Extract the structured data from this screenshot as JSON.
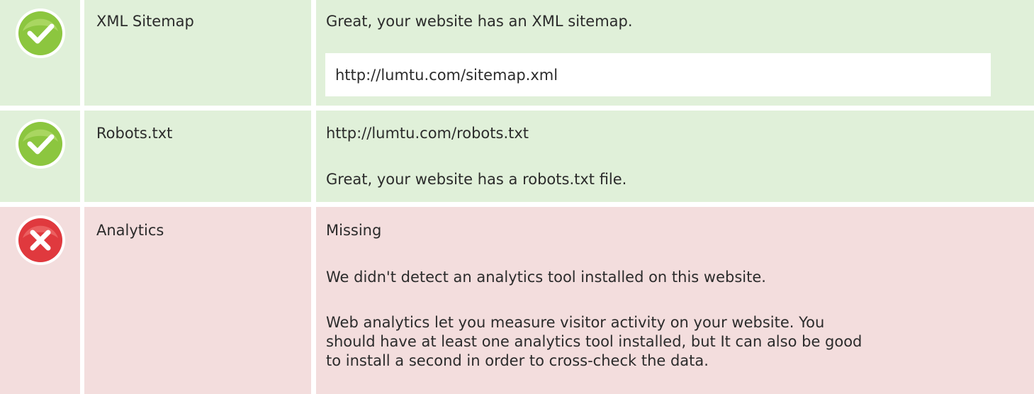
{
  "rows": [
    {
      "status": "pass",
      "icon": "check-circle-icon",
      "label": "XML Sitemap",
      "message": "Great, your website has an XML sitemap.",
      "url": "http://lumtu.com/sitemap.xml"
    },
    {
      "status": "pass",
      "icon": "check-circle-icon",
      "label": "Robots.txt",
      "url": "http://lumtu.com/robots.txt",
      "message": "Great, your website has a robots.txt file."
    },
    {
      "status": "fail",
      "icon": "x-circle-icon",
      "label": "Analytics",
      "status_text": "Missing",
      "message": "We didn't detect an analytics tool installed on this website.",
      "description": "Web analytics let you measure visitor activity on your website. You should have at least one analytics tool installed, but It can also be good to install a second in order to cross-check the data."
    }
  ],
  "colors": {
    "pass_background": "#e0f0d9",
    "fail_background": "#f3dddd",
    "pass_icon": "#8cc63f",
    "fail_icon": "#e0393e",
    "text": "#2b2b2b"
  }
}
